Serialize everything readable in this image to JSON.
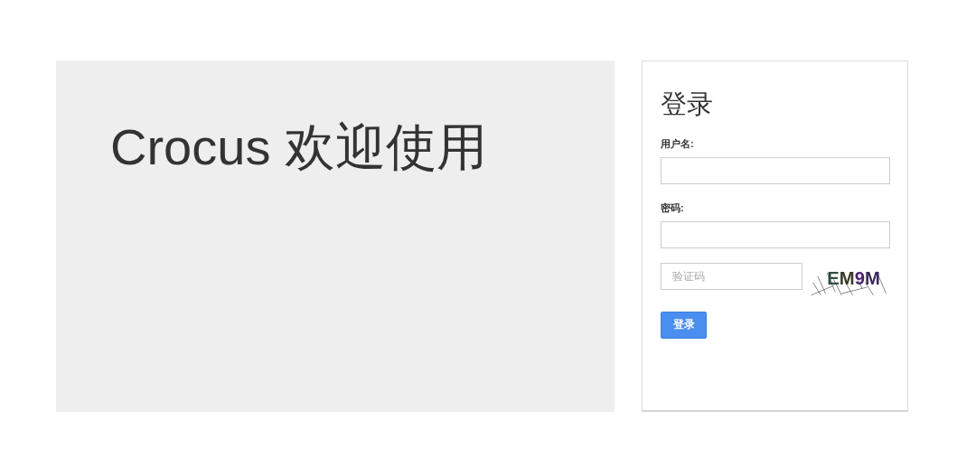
{
  "welcome": {
    "title": "Crocus 欢迎使用"
  },
  "login": {
    "title": "登录",
    "fields": [
      {
        "label": "用户名:"
      },
      {
        "label": "密码:"
      }
    ],
    "captcha": {
      "placeholder": "验证码",
      "code": "EM9M"
    },
    "submit": "登录"
  }
}
